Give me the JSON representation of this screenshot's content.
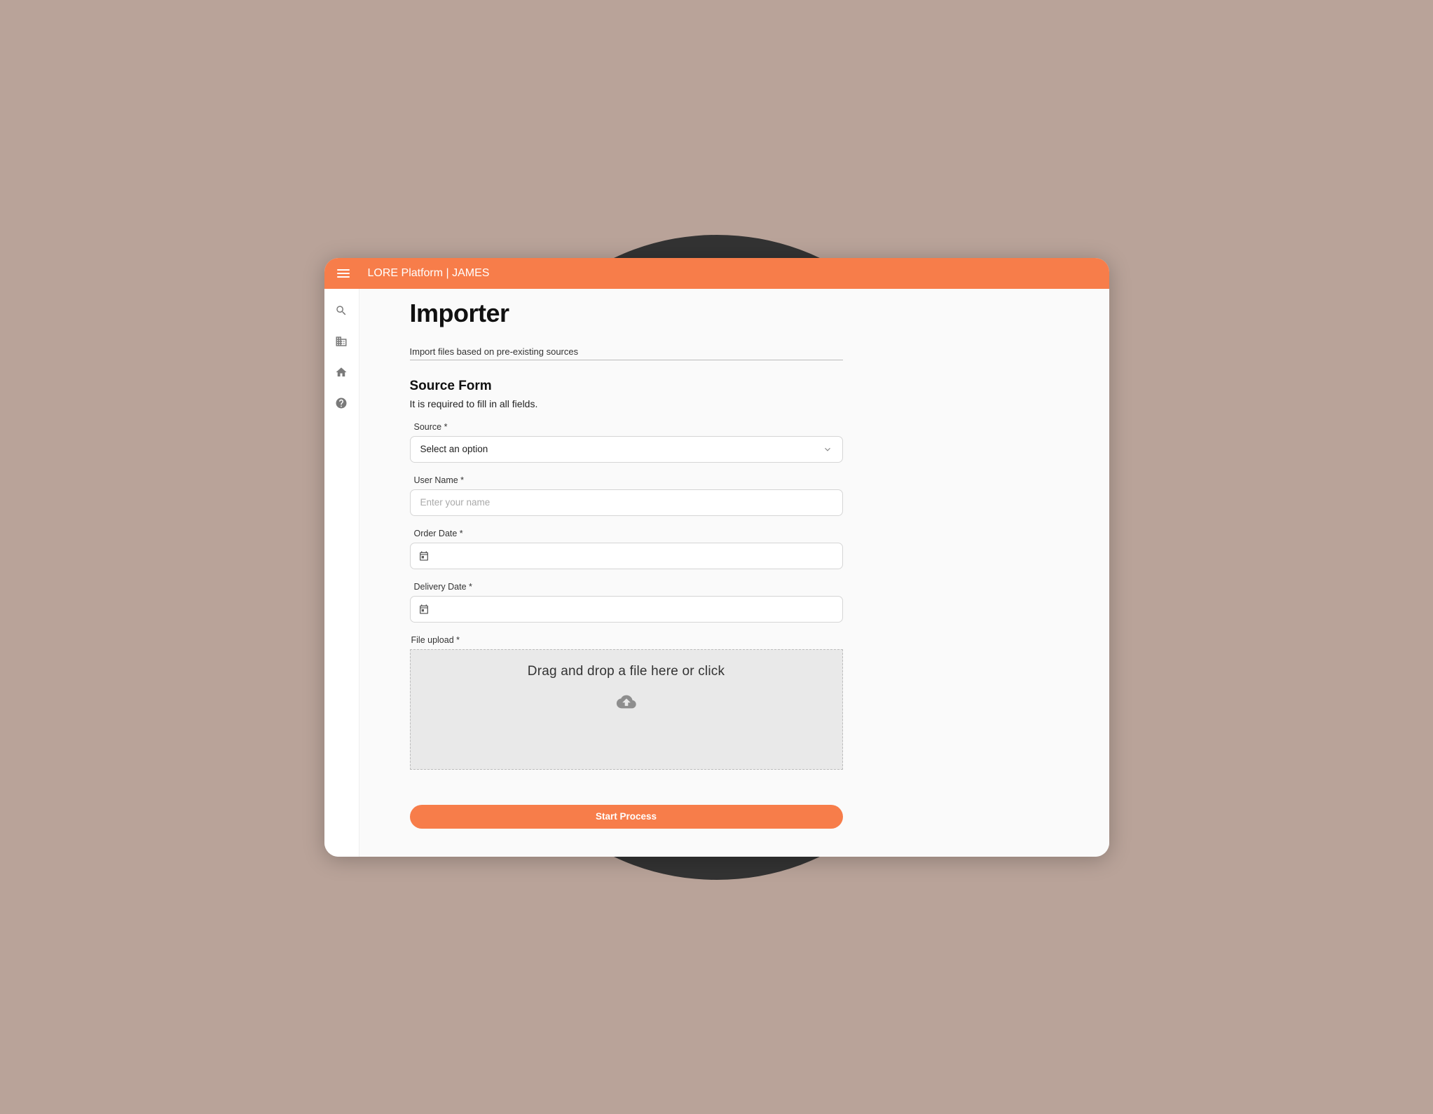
{
  "header": {
    "title": "LORE Platform | JAMES"
  },
  "page": {
    "title": "Importer",
    "subtitle": "Import files based on pre-existing sources"
  },
  "form": {
    "section_title": "Source Form",
    "section_help": "It is required to fill in all fields.",
    "fields": {
      "source": {
        "label": "Source *",
        "placeholder": "Select an option"
      },
      "username": {
        "label": "User Name *",
        "placeholder": "Enter your name"
      },
      "order_date": {
        "label": "Order Date *"
      },
      "delivery_date": {
        "label": "Delivery Date *"
      },
      "file_upload": {
        "label": "File upload *",
        "dropzone_text": "Drag and drop a file here or click"
      }
    },
    "submit_label": "Start Process"
  },
  "sidebar": {
    "items": [
      "search",
      "business",
      "home",
      "help"
    ]
  },
  "colors": {
    "accent": "#f77d4a"
  }
}
